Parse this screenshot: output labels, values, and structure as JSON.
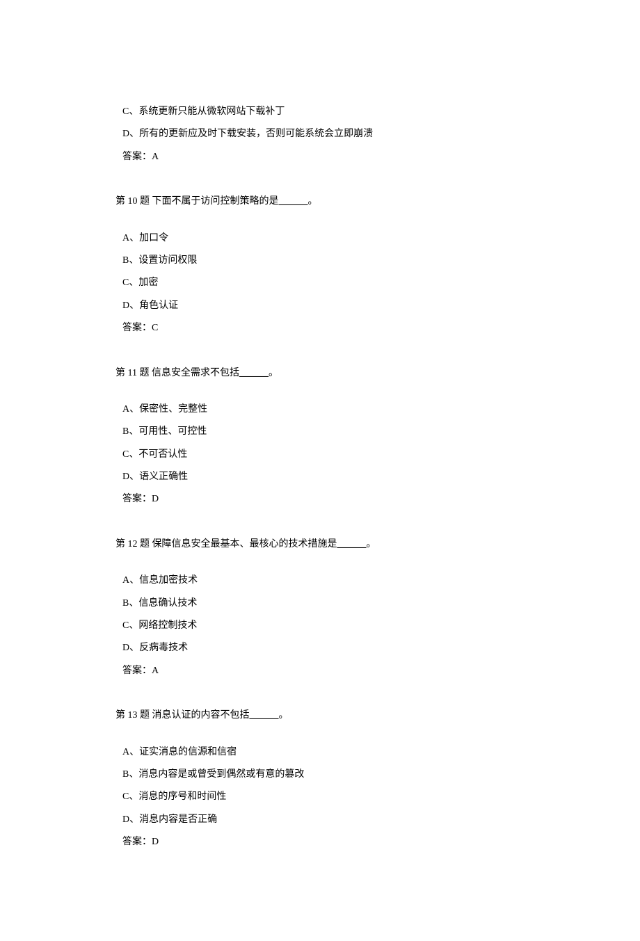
{
  "q9_tail": {
    "option_c": "C、系统更新只能从微软网站下载补丁",
    "option_d": "D、所有的更新应及时下载安装，否则可能系统会立即崩溃",
    "answer": "答案：A"
  },
  "q10": {
    "prompt_prefix": "第 10 题  下面不属于访问控制策略的是",
    "prompt_blank": "______",
    "prompt_suffix": "。",
    "option_a": "A、加口令",
    "option_b": "B、设置访问权限",
    "option_c": "C、加密",
    "option_d": "D、角色认证",
    "answer": "答案：C"
  },
  "q11": {
    "prompt_prefix": "第 11 题  信息安全需求不包括",
    "prompt_blank": "______",
    "prompt_suffix": "。",
    "option_a": "A、保密性、完整性",
    "option_b": "B、可用性、可控性",
    "option_c": "C、不可否认性",
    "option_d": "D、语义正确性",
    "answer": "答案：D"
  },
  "q12": {
    "prompt_prefix": "第 12 题  保障信息安全最基本、最核心的技术措施是",
    "prompt_blank": "______",
    "prompt_suffix": "。",
    "option_a": "A、信息加密技术",
    "option_b": "B、信息确认技术",
    "option_c": "C、网络控制技术",
    "option_d": "D、反病毒技术",
    "answer": "答案：A"
  },
  "q13": {
    "prompt_prefix": "第 13 题  消息认证的内容不包括",
    "prompt_blank": "______",
    "prompt_suffix": "。",
    "option_a": "A、证实消息的信源和信宿",
    "option_b": "B、消息内容是或曾受到偶然或有意的篡改",
    "option_c": "C、消息的序号和时间性",
    "option_d": "D、消息内容是否正确",
    "answer": "答案：D"
  }
}
